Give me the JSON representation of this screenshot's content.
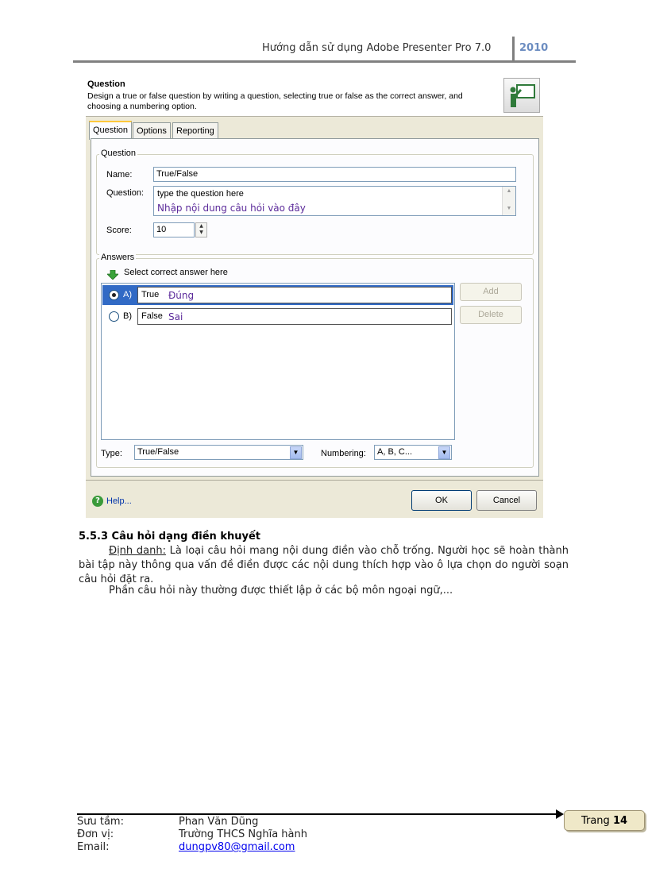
{
  "header": {
    "title": "Hướng dẫn sử dụng Adobe Presenter Pro 7.0",
    "year": "2010"
  },
  "dialog": {
    "title": "Question",
    "description": "Design a true or false question by writing a question, selecting true or false as the correct answer, and choosing a numbering option.",
    "tabs": [
      "Question",
      "Options",
      "Reporting"
    ],
    "question_group": {
      "label": "Question",
      "name_label": "Name:",
      "name_value": "True/False",
      "question_label": "Question:",
      "question_value": "type the question here",
      "question_note": "Nhập nội dung câu hỏi vào đây",
      "score_label": "Score:",
      "score_value": "10"
    },
    "answers_group": {
      "label": "Answers",
      "hint": "Select correct answer here",
      "answers": [
        {
          "letter": "A)",
          "value": "True",
          "note": "Đúng",
          "selected": true
        },
        {
          "letter": "B)",
          "value": "False",
          "note": "Sai",
          "selected": false
        }
      ],
      "add_label": "Add",
      "delete_label": "Delete"
    },
    "type_label": "Type:",
    "type_value": "True/False",
    "numbering_label": "Numbering:",
    "numbering_value": "A, B, C...",
    "help_label": "Help...",
    "ok_label": "OK",
    "cancel_label": "Cancel"
  },
  "section": {
    "title": "5.5.3 Câu hỏi dạng điền khuyết",
    "def_label": "Định danh:",
    "def_text": " Là loại câu hỏi mang nội dung điền vào chỗ trống. Người học sẽ hoàn thành bài tập này thông qua vấn đề điền được các nội dung thích hợp vào ô lựa chọn do người soạn câu hỏi đặt ra.",
    "para2": "Phần câu hỏi này thường được thiết lập ở các bộ môn ngoại ngữ,..."
  },
  "footer": {
    "collector_label": "Sưu tầm:",
    "collector_value": "Phan Văn Dũng",
    "unit_label": "Đơn vị:",
    "unit_value": "Trường THCS Nghĩa hành",
    "email_label": "Email:",
    "email_value": "dungpv80@gmail.com",
    "page_label": "Trang",
    "page_number": "14"
  }
}
